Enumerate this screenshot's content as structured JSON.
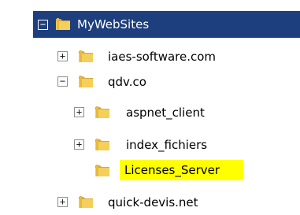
{
  "tree": {
    "root": {
      "label": "MyWebSites",
      "expander": "−",
      "icon": "folder-icon"
    },
    "children": [
      {
        "label": "iaes-software.com",
        "expander": "+",
        "icon": "folder-icon"
      },
      {
        "label": "qdv.co",
        "expander": "−",
        "icon": "folder-icon",
        "children": [
          {
            "label": "aspnet_client",
            "expander": "+",
            "icon": "folder-icon"
          },
          {
            "label": "index_fichiers",
            "expander": "+",
            "icon": "folder-icon"
          },
          {
            "label": "Licenses_Server",
            "icon": "folder-icon",
            "highlight_color": "#ffff00"
          }
        ]
      },
      {
        "label": "quick-devis.net",
        "expander": "+",
        "icon": "folder-icon"
      }
    ]
  },
  "colors": {
    "selection": "#1e3f7e",
    "folder": "#f2c84b",
    "highlight": "#ffff00"
  }
}
